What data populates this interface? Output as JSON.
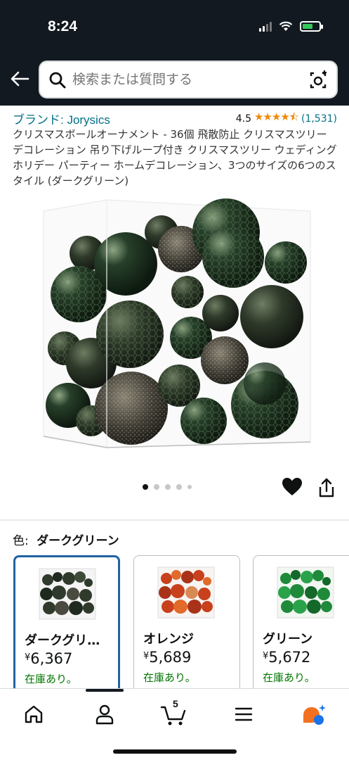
{
  "status_bar": {
    "time": "8:24"
  },
  "search": {
    "placeholder": "検索または質問する"
  },
  "product": {
    "brand_label": "ブランド: Jorysics",
    "rating_value": "4.5",
    "rating_stars": 4.5,
    "rating_count": "(1,531)",
    "title": "クリスマスボールオーナメント - 36個 飛散防止 クリスマスツリーデコレーション 吊り下げループ付き クリスマスツリー ウェディング ホリデー パーティー ホームデコレーション、3つのサイズの6つのスタイル (ダークグリーン)",
    "image_count": 5,
    "active_image": 1
  },
  "color_selector": {
    "label": "色:",
    "selected_value": "ダークグリーン"
  },
  "variants": [
    {
      "name": "ダークグリ…",
      "price": "6,367",
      "currency": "¥",
      "stock": "在庫あり。",
      "selected": true,
      "color": "#2f3a2c"
    },
    {
      "name": "オレンジ",
      "price": "5,689",
      "currency": "¥",
      "stock": "在庫あり。",
      "selected": false,
      "color": "#c8401c"
    },
    {
      "name": "グリーン",
      "price": "5,672",
      "currency": "¥",
      "stock": "在庫あり。",
      "selected": false,
      "color": "#1e8a3a"
    }
  ],
  "bottom_nav": {
    "cart_count": "5",
    "items": [
      "home-icon",
      "account-icon",
      "cart-icon",
      "menu-icon",
      "rufus-icon"
    ]
  },
  "colors": {
    "header_bg": "#131921",
    "link": "#007185",
    "star": "#f08804",
    "in_stock": "#007600",
    "selected_border": "#2162a1"
  }
}
